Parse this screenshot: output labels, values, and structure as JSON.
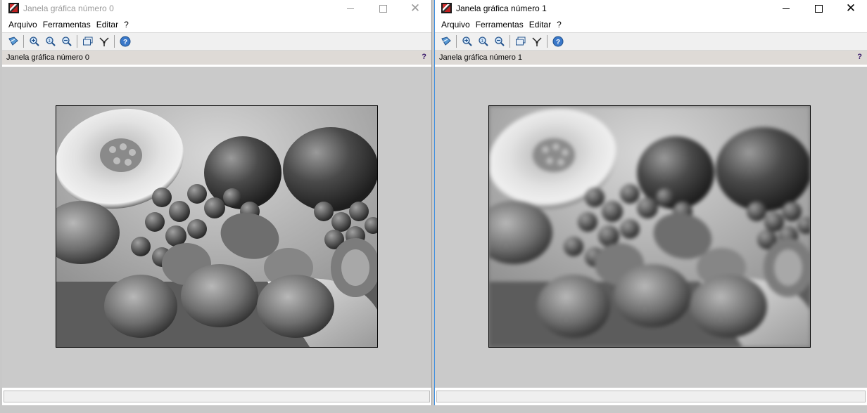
{
  "windows": [
    {
      "title": "Janela gráfica número 0",
      "menu": [
        "Arquivo",
        "Ferramentas",
        "Editar",
        "?"
      ],
      "info_label": "Janela gráfica número 0",
      "info_help": "?",
      "image_content": "grayscale-fruit-photo",
      "active": false
    },
    {
      "title": "Janela gráfica número 1",
      "menu": [
        "Arquivo",
        "Ferramentas",
        "Editar",
        "?"
      ],
      "info_label": "Janela gráfica número 1",
      "info_help": "?",
      "image_content": "grayscale-fruit-photo-blurred",
      "active": true
    }
  ],
  "icons": {
    "close_glyph": "✕",
    "toolbar": [
      "rotate-3d-icon",
      "zoom-icon",
      "zoom-in-icon",
      "zoom-out-icon",
      "new-window-icon",
      "datatips-icon",
      "help-icon"
    ]
  },
  "colors": {
    "canvas_bg": "#cacaca",
    "infobar_bg": "#dedad6",
    "active_border": "#3d8ee0"
  }
}
